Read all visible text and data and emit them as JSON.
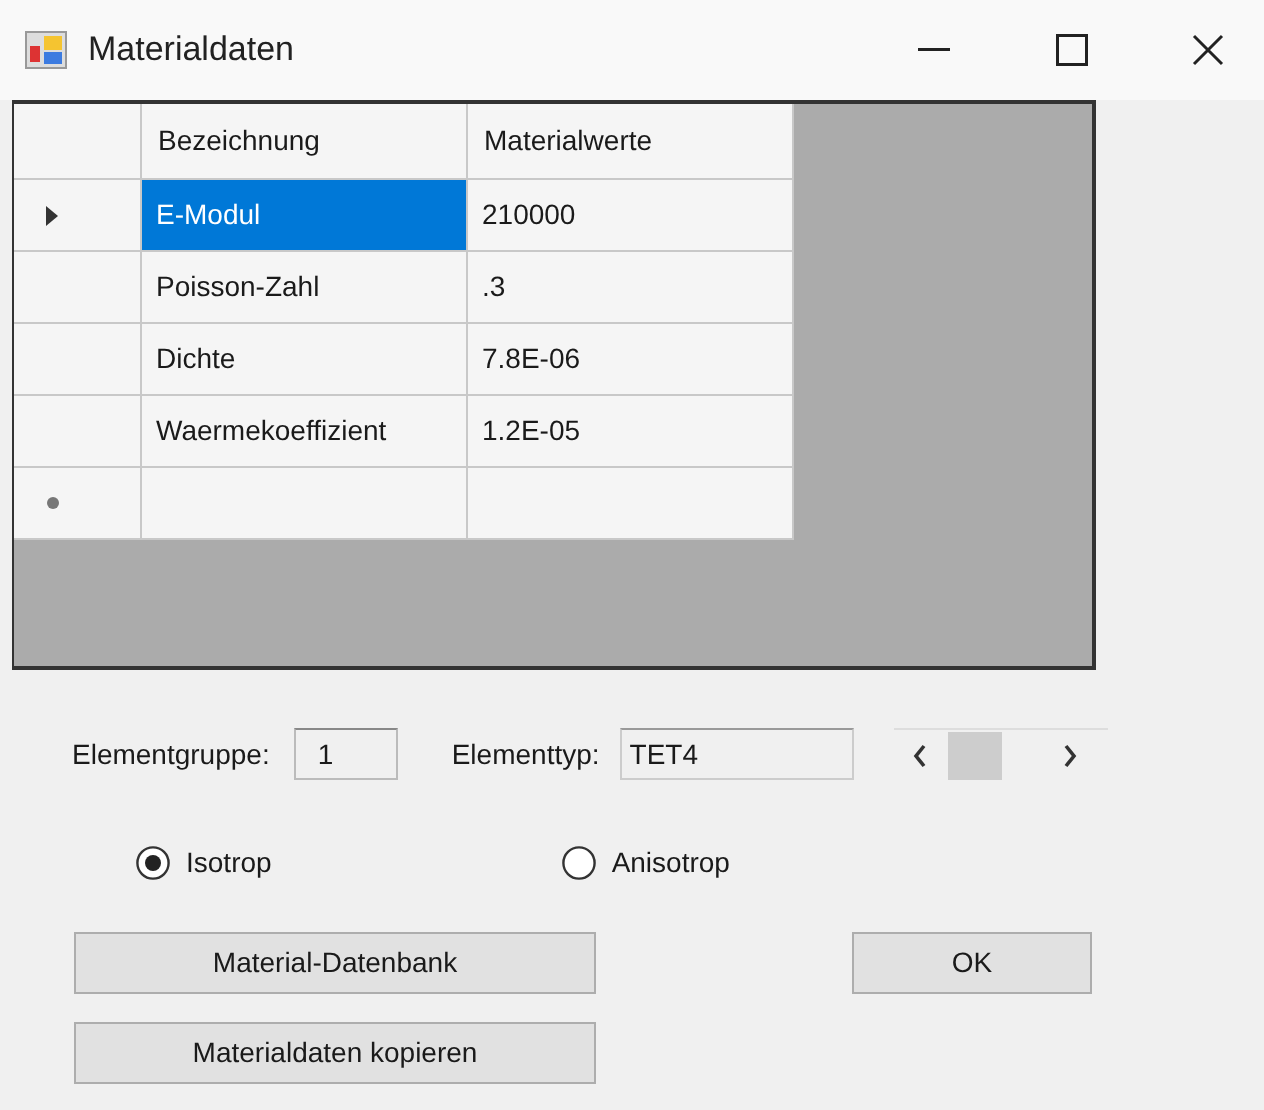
{
  "window": {
    "title": "Materialdaten"
  },
  "table": {
    "columns": [
      "Bezeichnung",
      "Materialwerte"
    ],
    "rows": [
      {
        "kind": "data",
        "current": true,
        "cells": [
          {
            "text": "E-Modul",
            "selected": true
          },
          {
            "text": "210000",
            "selected": false
          }
        ]
      },
      {
        "kind": "data",
        "current": false,
        "cells": [
          {
            "text": "Poisson-Zahl",
            "selected": false
          },
          {
            "text": ".3",
            "selected": false
          }
        ]
      },
      {
        "kind": "data",
        "current": false,
        "cells": [
          {
            "text": "Dichte",
            "selected": false
          },
          {
            "text": "7.8E-06",
            "selected": false
          }
        ]
      },
      {
        "kind": "data",
        "current": false,
        "cells": [
          {
            "text": "Waermekoeffizient",
            "selected": false
          },
          {
            "text": "1.2E-05",
            "selected": false
          }
        ]
      },
      {
        "kind": "new",
        "cells": [
          {
            "selected": false
          },
          {
            "selected": false
          }
        ]
      }
    ]
  },
  "element_group": {
    "label": "Elementgruppe:",
    "value": "1"
  },
  "element_type": {
    "label": "Elementtyp:",
    "value": "TET4"
  },
  "radios": [
    {
      "label": "Isotrop",
      "selected": true
    },
    {
      "label": "Anisotrop",
      "selected": false
    }
  ],
  "buttons": {
    "database": "Material-Datenbank",
    "ok": "OK",
    "copy": "Materialdaten kopieren"
  }
}
